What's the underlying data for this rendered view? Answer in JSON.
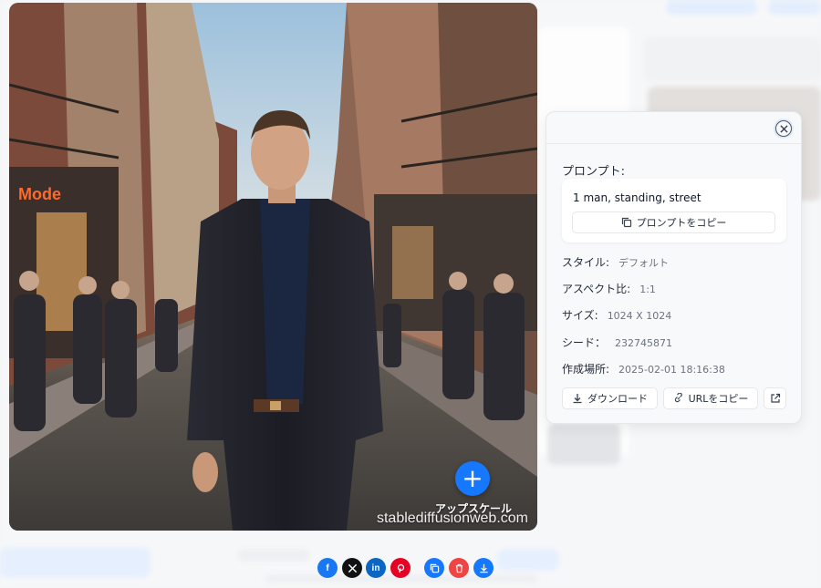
{
  "image": {
    "watermark": "stablediffusionweb.com",
    "upscale_label": "アップスケール"
  },
  "panel": {
    "prompt_title": "プロンプト:",
    "prompt_text": "1 man, standing, street",
    "copy_prompt_label": "プロンプトをコピー",
    "meta": [
      {
        "label": "スタイル:",
        "value": "デフォルト"
      },
      {
        "label": "アスペクト比:",
        "value": "1:1"
      },
      {
        "label": "サイズ:",
        "value": "1024 X 1024"
      },
      {
        "label": "シード：",
        "value": "232745871"
      },
      {
        "label": "作成場所:",
        "value": "2025-02-01 18:16:38"
      }
    ],
    "download_label": "ダウンロード",
    "copy_url_label": "URLをコピー"
  },
  "share": {
    "facebook": "f",
    "linkedin": "in",
    "colors": {
      "facebook": "#1877f2",
      "x": "#111111",
      "linkedin": "#0a66c2",
      "pinterest": "#e60023",
      "copy": "#1677ff",
      "delete": "#ef4444",
      "download": "#1677ff"
    }
  },
  "colors": {
    "accent": "#1677ff",
    "panel_bg": "#f8f9fb"
  }
}
